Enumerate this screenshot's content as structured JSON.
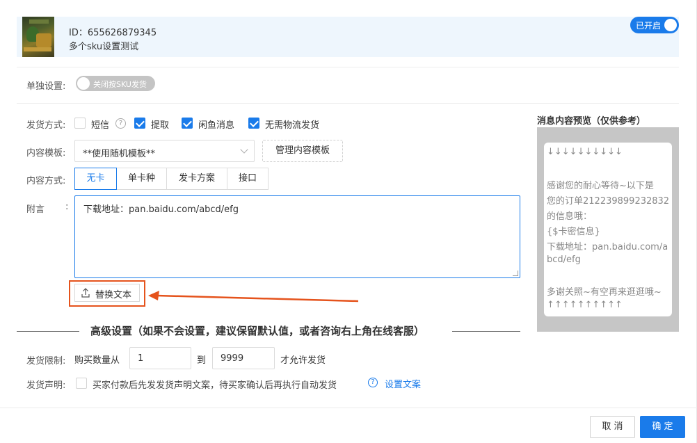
{
  "product": {
    "id_text": "ID：655626879345",
    "name": "多个sku设置测试",
    "status_toggle_label": "已开启"
  },
  "single_setting": {
    "label": "单独设置:",
    "toggle_label": "关闭按SKU发货"
  },
  "delivery_method": {
    "label": "发货方式:",
    "options": [
      {
        "label": "短信",
        "checked": false
      },
      {
        "label": "提取",
        "checked": true
      },
      {
        "label": "闲鱼消息",
        "checked": true
      },
      {
        "label": "无需物流发货",
        "checked": true
      }
    ]
  },
  "content_template": {
    "label": "内容模板:",
    "selected": "**使用随机模板**",
    "manage_button": "管理内容模板"
  },
  "content_mode": {
    "label": "内容方式:",
    "tabs": [
      "无卡",
      "单卡种",
      "发卡方案",
      "接口"
    ],
    "active": "无卡"
  },
  "note": {
    "label": "附言",
    "colon": ":",
    "value": "下载地址：pan.baidu.com/abcd/efg",
    "replace_button": "替换文本"
  },
  "advanced": {
    "title": "高级设置（如果不会设置，建议保留默认值，或者咨询右上角在线客服）"
  },
  "limit": {
    "label": "发货限制:",
    "prefix": "购买数量从",
    "min": "1",
    "to": "到",
    "max": "9999",
    "suffix": "才允许发货"
  },
  "statement": {
    "label": "发货声明:",
    "text": "买家付款后先发发货声明文案，待买家确认后再执行自动发货",
    "link": "设置文案"
  },
  "preview": {
    "title": "消息内容预览（仅供参考）",
    "lines": [
      "↓↓↓↓↓↓↓↓↓↓",
      "",
      "感谢您的耐心等待~以下是",
      "您的订单212239899232832",
      "的信息哦：",
      "{$卡密信息}",
      "下载地址：pan.baidu.com/a",
      "bcd/efg",
      "",
      "多谢关照~有空再来逛逛哦~",
      "↑↑↑↑↑↑↑↑↑↑"
    ]
  },
  "footer": {
    "cancel": "取 消",
    "confirm": "确 定"
  },
  "colors": {
    "accent": "#1a7bea",
    "highlight": "#e5531c"
  }
}
